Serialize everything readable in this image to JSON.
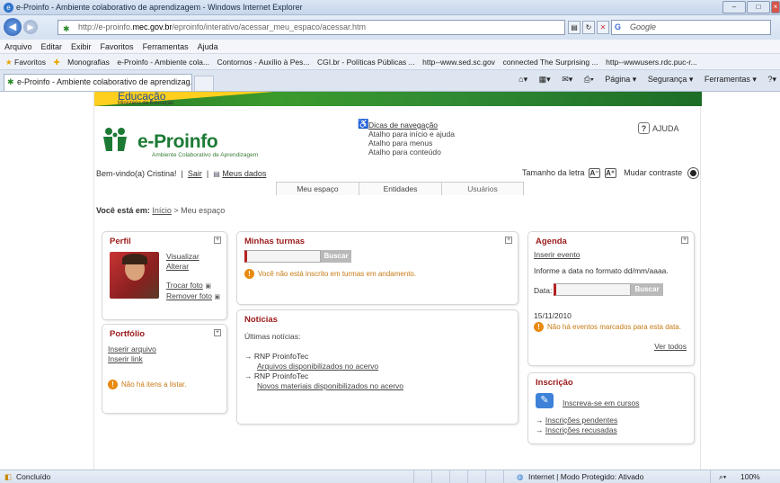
{
  "window": {
    "title": "e-Proinfo - Ambiente colaborativo de aprendizagem - Windows Internet Explorer",
    "url_prefix": "http://e-proinfo.",
    "url_host": "mec.gov.br",
    "url_path": "/eproinfo/interativo/acessar_meu_espaco/acessar.htm",
    "search_engine": "Google"
  },
  "menu": [
    "Arquivo",
    "Editar",
    "Exibir",
    "Favoritos",
    "Ferramentas",
    "Ajuda"
  ],
  "favorites": {
    "label": "Favoritos",
    "items": [
      "Monografias",
      "e-Proinfo - Ambiente cola...",
      "Contornos - Auxílio à Pes...",
      "CGI.br - Políticas Públicas ...",
      "http--www.sed.sc.gov",
      "connected The Surprising ...",
      "http--wwwusers.rdc.puc-r..."
    ]
  },
  "tab": {
    "label": "e-Proinfo - Ambiente colaborativo de aprendizag...",
    "commands": [
      "Página ▾",
      "Segurança ▾",
      "Ferramentas ▾"
    ]
  },
  "header": {
    "education": "Educação",
    "ministry": "Ministério da Educação",
    "brand": "e-Proinfo",
    "brand_sub": "Ambiente Colaborativo de Aprendizagem",
    "accessibility": {
      "tips": "Dicas de navegação",
      "shortcut1": "Atalho para início e ajuda",
      "shortcut2": "Atalho para menus",
      "shortcut3": "Atalho para conteúdo"
    },
    "help": "AJUDA"
  },
  "userbar": {
    "welcome": "Bem-vindo(a) Cristina!",
    "logout": "Sair",
    "mydata": "Meus dados",
    "font_size": "Tamanho da letra",
    "font_minus": "A",
    "font_plus": "A",
    "contrast": "Mudar contraste"
  },
  "nav": [
    "Meu espaço",
    "Entidades",
    "Usuários"
  ],
  "breadcrumb": {
    "label": "Você está em:",
    "home": "Início",
    "current": "> Meu espaço"
  },
  "perfil": {
    "title": "Perfil",
    "view": "Visualizar",
    "edit": "Alterar",
    "change_photo": "Trocar foto",
    "remove_photo": "Remover foto"
  },
  "portfolio": {
    "title": "Portfólio",
    "insert_file": "Inserir arquivo",
    "insert_link": "Inserir link",
    "empty": "Não há itens a listar."
  },
  "turmas": {
    "title": "Minhas turmas",
    "search_button": "Buscar",
    "message": "Você não está inscrito em turmas em andamento."
  },
  "noticias": {
    "title": "Notícias",
    "subtitle": "Últimas notícias:",
    "items": [
      {
        "source": "RNP ProinfoTec",
        "headline": "Arquivos disponibilizados no acervo"
      },
      {
        "source": "RNP ProinfoTec",
        "headline": "Novos materiais disponibilizados no acervo"
      }
    ]
  },
  "agenda": {
    "title": "Agenda",
    "insert": "Inserir evento",
    "instruction": "Informe a data no formato dd/mm/aaaa.",
    "date_label": "Data:",
    "search_button": "Buscar",
    "date": "15/11/2010",
    "no_events": "Não há eventos marcados para esta data.",
    "see_all": "Ver todos"
  },
  "inscricao": {
    "title": "Inscrição",
    "enroll": "Inscreva-se em cursos",
    "pending": "Inscrições pendentes",
    "refused": "Inscrições recusadas"
  },
  "status": {
    "text": "Concluído",
    "zone": "Internet | Modo Protegido: Ativado",
    "zoom": "100%"
  }
}
